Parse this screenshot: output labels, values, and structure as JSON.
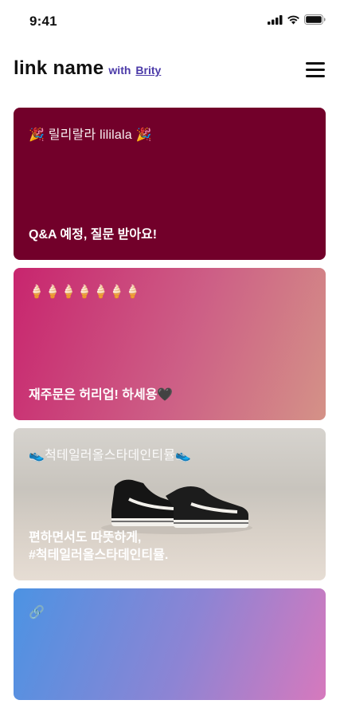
{
  "status": {
    "time": "9:41"
  },
  "header": {
    "name": "link name",
    "with": "with",
    "brand": "Brity"
  },
  "cards": [
    {
      "title": "🎉 릴리랄라 lililala 🎉",
      "desc": "Q&A 예정, 질문 받아요!"
    },
    {
      "title": "🍦🍦🍦🍦🍦🍦🍦",
      "desc": "재주문은 허리업! 하세용🖤"
    },
    {
      "title": "👟척테일러올스타데인티뮬👟",
      "desc": "편하면서도 따뜻하게,\n#척테일러올스타데인티뮬."
    },
    {
      "title": "🔗",
      "desc": ""
    }
  ],
  "colors": {
    "accent": "#4b3aa8",
    "card1": "#72002a"
  },
  "icons": [
    "signal-icon",
    "wifi-icon",
    "battery-icon",
    "hamburger-menu-icon",
    "sneakers-image"
  ]
}
